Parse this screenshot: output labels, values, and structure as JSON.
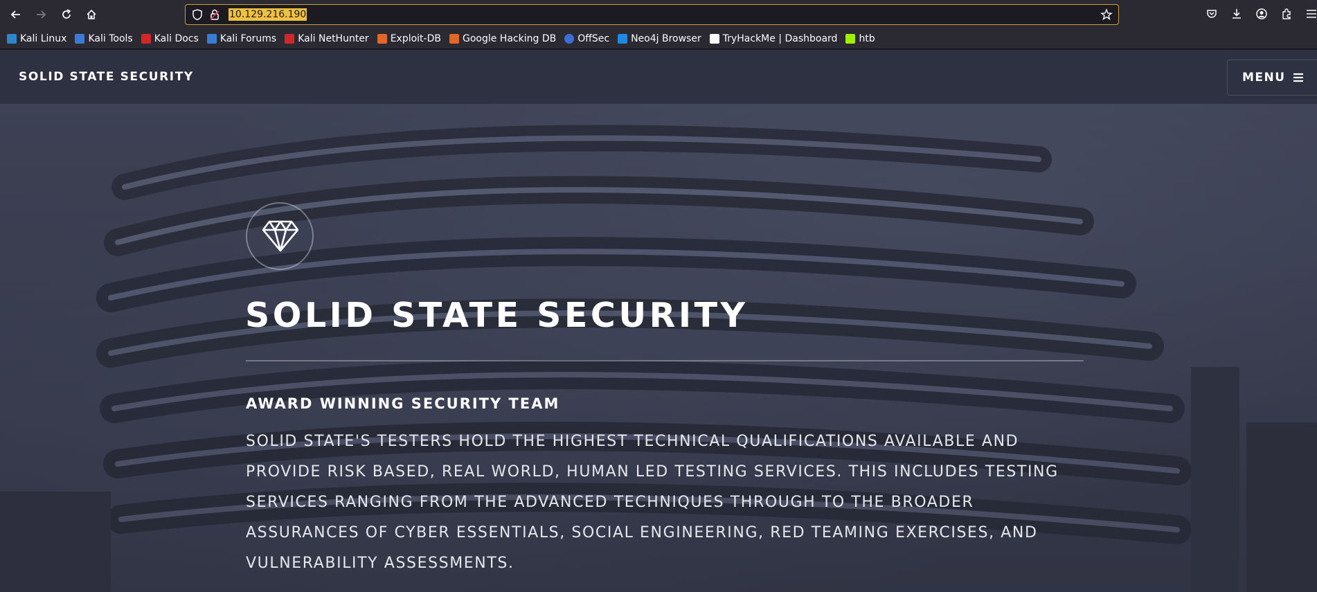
{
  "browser": {
    "url": "10.129.216.190",
    "bookmarks": [
      {
        "label": "Kali Linux",
        "color": "#2d86c9"
      },
      {
        "label": "Kali Tools",
        "color": "#3a7bd5"
      },
      {
        "label": "Kali Docs",
        "color": "#d02828"
      },
      {
        "label": "Kali Forums",
        "color": "#3a7bd5"
      },
      {
        "label": "Kali NetHunter",
        "color": "#d02828"
      },
      {
        "label": "Exploit-DB",
        "color": "#e0662a"
      },
      {
        "label": "Google Hacking DB",
        "color": "#e0662a"
      },
      {
        "label": "OffSec",
        "color": "#3a6fd8"
      },
      {
        "label": "Neo4j Browser",
        "color": "#1e88e5"
      },
      {
        "label": "TryHackMe | Dashboard",
        "color": "#ffffff"
      },
      {
        "label": "htb",
        "color": "#9fef00"
      }
    ]
  },
  "site": {
    "title": "SOLID STATE SECURITY",
    "menu_label": "MENU"
  },
  "hero": {
    "title": "SOLID STATE SECURITY",
    "subtitle": "AWARD WINNING SECURITY TEAM",
    "body": "Solid State's testers hold the highest technical qualifications available and provide risk based, real world, human led testing services. This includes testing services ranging from the advanced techniques through to the broader assurances of Cyber Essentials, social engineering, red teaming exercises, and vulnerability assessments."
  },
  "colors": {
    "accent_url_highlight": "#f0c040",
    "url_border": "#c8a33a",
    "header_bg": "#2e3141"
  },
  "icons": [
    "back-icon",
    "forward-icon",
    "reload-icon",
    "home-icon",
    "shield-icon",
    "lock-icon",
    "star-icon",
    "pocket-icon",
    "download-icon",
    "account-icon",
    "extensions-icon",
    "hamburger-icon",
    "diamond-icon"
  ]
}
